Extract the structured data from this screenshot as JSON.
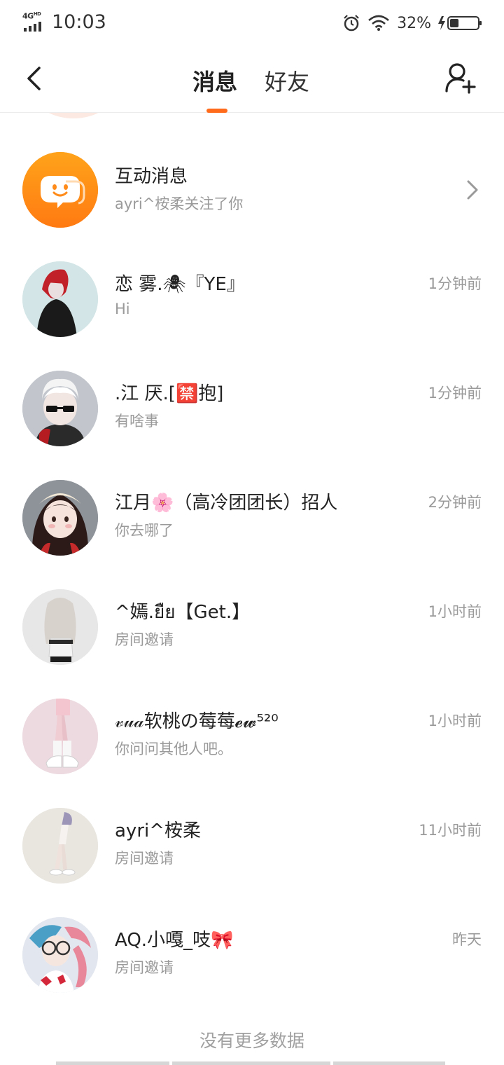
{
  "status_bar": {
    "network": "4G",
    "network_hd": "HD",
    "time": "10:03",
    "battery": "32%",
    "battery_level": 0.32
  },
  "nav": {
    "tabs": [
      {
        "label": "消息",
        "active": true
      },
      {
        "label": "好友",
        "active": false
      }
    ],
    "accent_color": "#ff6b1a"
  },
  "messages": [
    {
      "name": "互动消息",
      "preview": "ayri^桉柔关注了你",
      "time": "",
      "avatar_icon": "chat-bubble-smile-icon",
      "avatar_color": "#ff8c1a"
    },
    {
      "name": "恋 雾.🕷『YE』",
      "preview": "Hi",
      "time": "1分钟前"
    },
    {
      "name": ".江  厌.[🈲抱]",
      "preview": "有啥事",
      "time": "1分钟前"
    },
    {
      "name": "江月🌸（高冷团团长）招人",
      "preview": "你去哪了",
      "time": "2分钟前"
    },
    {
      "name": "^嫣.ยืย【Get.】",
      "preview": "房间邀请",
      "time": "1小时前"
    },
    {
      "name": "𝓋𝓊𝒶软桃の莓莓𝓮𝔀⁵²⁰",
      "preview": "你问问其他人吧。",
      "time": "1小时前"
    },
    {
      "name": "ayri^桉柔",
      "preview": "房间邀请",
      "time": "11小时前"
    },
    {
      "name": "AQ.小嘎_吱🎀",
      "preview": "房间邀请",
      "time": "昨天"
    }
  ],
  "footer": "没有更多数据"
}
